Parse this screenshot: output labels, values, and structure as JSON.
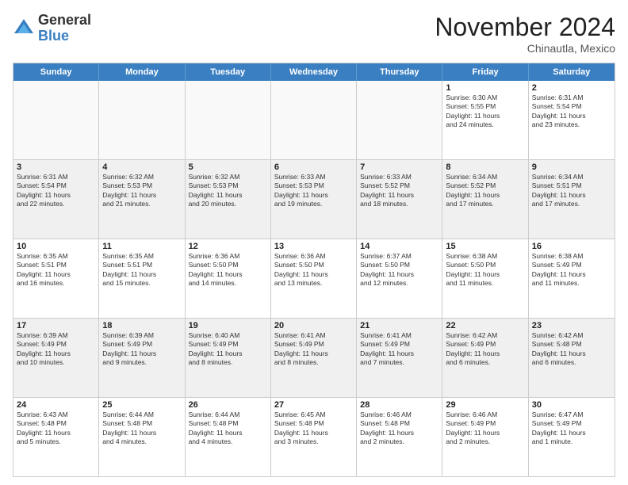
{
  "logo": {
    "general": "General",
    "blue": "Blue"
  },
  "header": {
    "month": "November 2024",
    "location": "Chinautla, Mexico"
  },
  "days_of_week": [
    "Sunday",
    "Monday",
    "Tuesday",
    "Wednesday",
    "Thursday",
    "Friday",
    "Saturday"
  ],
  "weeks": [
    [
      {
        "day": "",
        "info": "",
        "empty": true
      },
      {
        "day": "",
        "info": "",
        "empty": true
      },
      {
        "day": "",
        "info": "",
        "empty": true
      },
      {
        "day": "",
        "info": "",
        "empty": true
      },
      {
        "day": "",
        "info": "",
        "empty": true
      },
      {
        "day": "1",
        "info": "Sunrise: 6:30 AM\nSunset: 5:55 PM\nDaylight: 11 hours\nand 24 minutes."
      },
      {
        "day": "2",
        "info": "Sunrise: 6:31 AM\nSunset: 5:54 PM\nDaylight: 11 hours\nand 23 minutes."
      }
    ],
    [
      {
        "day": "3",
        "info": "Sunrise: 6:31 AM\nSunset: 5:54 PM\nDaylight: 11 hours\nand 22 minutes.",
        "shaded": true
      },
      {
        "day": "4",
        "info": "Sunrise: 6:32 AM\nSunset: 5:53 PM\nDaylight: 11 hours\nand 21 minutes.",
        "shaded": true
      },
      {
        "day": "5",
        "info": "Sunrise: 6:32 AM\nSunset: 5:53 PM\nDaylight: 11 hours\nand 20 minutes.",
        "shaded": true
      },
      {
        "day": "6",
        "info": "Sunrise: 6:33 AM\nSunset: 5:53 PM\nDaylight: 11 hours\nand 19 minutes.",
        "shaded": true
      },
      {
        "day": "7",
        "info": "Sunrise: 6:33 AM\nSunset: 5:52 PM\nDaylight: 11 hours\nand 18 minutes.",
        "shaded": true
      },
      {
        "day": "8",
        "info": "Sunrise: 6:34 AM\nSunset: 5:52 PM\nDaylight: 11 hours\nand 17 minutes.",
        "shaded": true
      },
      {
        "day": "9",
        "info": "Sunrise: 6:34 AM\nSunset: 5:51 PM\nDaylight: 11 hours\nand 17 minutes.",
        "shaded": true
      }
    ],
    [
      {
        "day": "10",
        "info": "Sunrise: 6:35 AM\nSunset: 5:51 PM\nDaylight: 11 hours\nand 16 minutes."
      },
      {
        "day": "11",
        "info": "Sunrise: 6:35 AM\nSunset: 5:51 PM\nDaylight: 11 hours\nand 15 minutes."
      },
      {
        "day": "12",
        "info": "Sunrise: 6:36 AM\nSunset: 5:50 PM\nDaylight: 11 hours\nand 14 minutes."
      },
      {
        "day": "13",
        "info": "Sunrise: 6:36 AM\nSunset: 5:50 PM\nDaylight: 11 hours\nand 13 minutes."
      },
      {
        "day": "14",
        "info": "Sunrise: 6:37 AM\nSunset: 5:50 PM\nDaylight: 11 hours\nand 12 minutes."
      },
      {
        "day": "15",
        "info": "Sunrise: 6:38 AM\nSunset: 5:50 PM\nDaylight: 11 hours\nand 11 minutes."
      },
      {
        "day": "16",
        "info": "Sunrise: 6:38 AM\nSunset: 5:49 PM\nDaylight: 11 hours\nand 11 minutes."
      }
    ],
    [
      {
        "day": "17",
        "info": "Sunrise: 6:39 AM\nSunset: 5:49 PM\nDaylight: 11 hours\nand 10 minutes.",
        "shaded": true
      },
      {
        "day": "18",
        "info": "Sunrise: 6:39 AM\nSunset: 5:49 PM\nDaylight: 11 hours\nand 9 minutes.",
        "shaded": true
      },
      {
        "day": "19",
        "info": "Sunrise: 6:40 AM\nSunset: 5:49 PM\nDaylight: 11 hours\nand 8 minutes.",
        "shaded": true
      },
      {
        "day": "20",
        "info": "Sunrise: 6:41 AM\nSunset: 5:49 PM\nDaylight: 11 hours\nand 8 minutes.",
        "shaded": true
      },
      {
        "day": "21",
        "info": "Sunrise: 6:41 AM\nSunset: 5:49 PM\nDaylight: 11 hours\nand 7 minutes.",
        "shaded": true
      },
      {
        "day": "22",
        "info": "Sunrise: 6:42 AM\nSunset: 5:49 PM\nDaylight: 11 hours\nand 6 minutes.",
        "shaded": true
      },
      {
        "day": "23",
        "info": "Sunrise: 6:42 AM\nSunset: 5:48 PM\nDaylight: 11 hours\nand 6 minutes.",
        "shaded": true
      }
    ],
    [
      {
        "day": "24",
        "info": "Sunrise: 6:43 AM\nSunset: 5:48 PM\nDaylight: 11 hours\nand 5 minutes."
      },
      {
        "day": "25",
        "info": "Sunrise: 6:44 AM\nSunset: 5:48 PM\nDaylight: 11 hours\nand 4 minutes."
      },
      {
        "day": "26",
        "info": "Sunrise: 6:44 AM\nSunset: 5:48 PM\nDaylight: 11 hours\nand 4 minutes."
      },
      {
        "day": "27",
        "info": "Sunrise: 6:45 AM\nSunset: 5:48 PM\nDaylight: 11 hours\nand 3 minutes."
      },
      {
        "day": "28",
        "info": "Sunrise: 6:46 AM\nSunset: 5:48 PM\nDaylight: 11 hours\nand 2 minutes."
      },
      {
        "day": "29",
        "info": "Sunrise: 6:46 AM\nSunset: 5:49 PM\nDaylight: 11 hours\nand 2 minutes."
      },
      {
        "day": "30",
        "info": "Sunrise: 6:47 AM\nSunset: 5:49 PM\nDaylight: 11 hours\nand 1 minute."
      }
    ]
  ]
}
